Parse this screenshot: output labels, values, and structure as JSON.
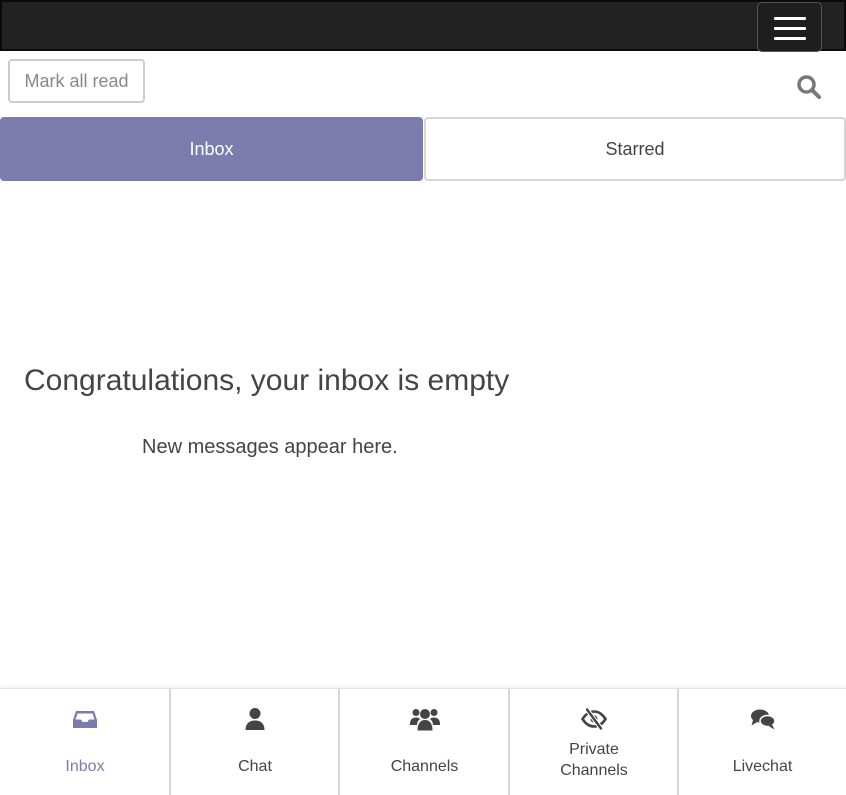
{
  "header": {
    "menu_icon": "hamburger-menu-icon"
  },
  "toolbar": {
    "mark_all_read_label": "Mark all read",
    "search_icon": "search-icon"
  },
  "tabs": [
    {
      "label": "Inbox",
      "active": true
    },
    {
      "label": "Starred",
      "active": false
    }
  ],
  "empty_state": {
    "title": "Congratulations, your inbox is empty",
    "subtitle": "New messages appear here."
  },
  "bottom_nav": {
    "items": [
      {
        "label": "Inbox",
        "icon": "inbox-tray-icon",
        "active": true
      },
      {
        "label": "Chat",
        "icon": "user-icon",
        "active": false
      },
      {
        "label_line1": "",
        "label": "Channels",
        "icon": "users-icon",
        "active": false
      },
      {
        "label_line1": "Private",
        "label_line2": "Channels",
        "icon": "eye-slash-icon",
        "active": false
      },
      {
        "label": "Livechat",
        "icon": "comments-icon",
        "active": false
      }
    ]
  },
  "colors": {
    "accent": "#7b7bae",
    "topbar": "#222222",
    "text": "#444444",
    "muted": "#888888"
  }
}
